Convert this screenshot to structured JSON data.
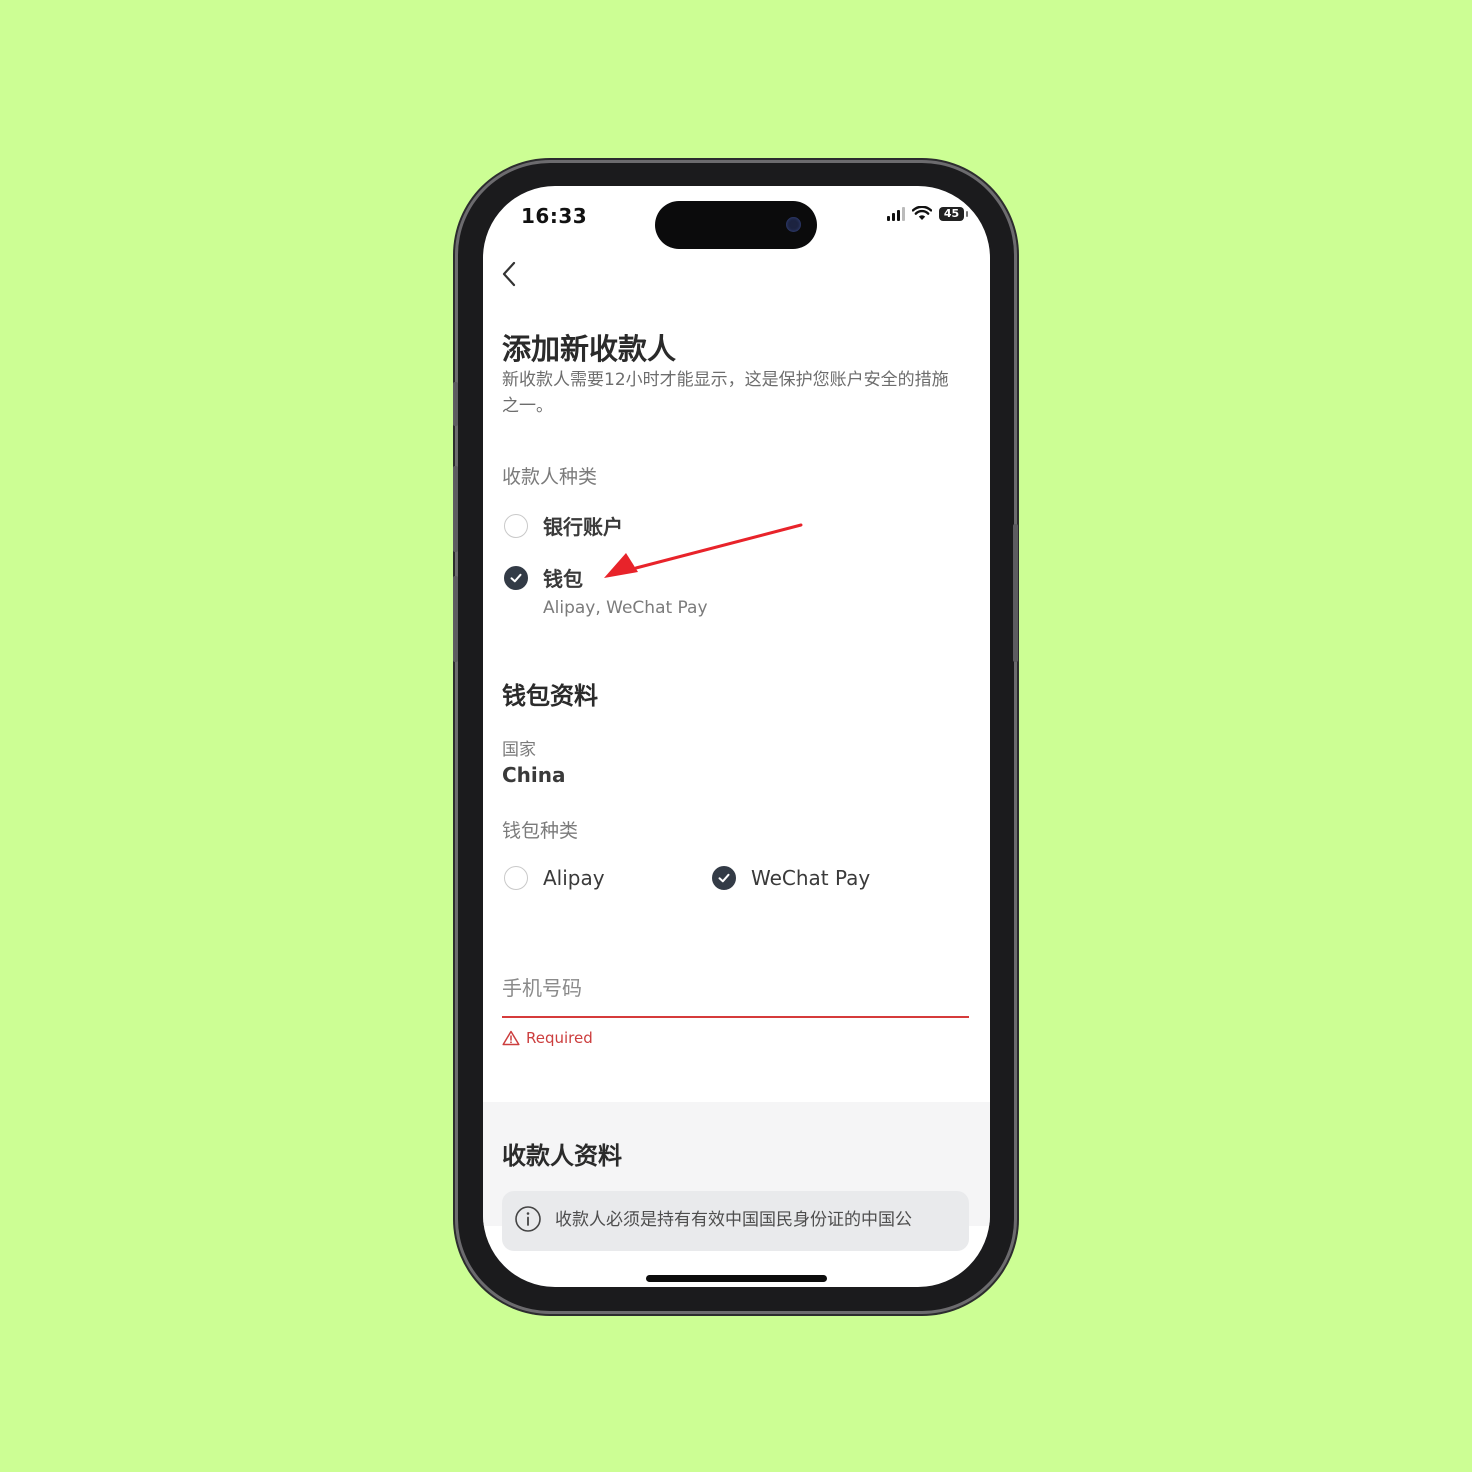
{
  "status_bar": {
    "time": "16:33",
    "battery": "45"
  },
  "header": {
    "title": "添加新收款人",
    "subtitle": "新收款人需要12小时才能显示，这是保护您账户安全的措施之一。"
  },
  "payee_type": {
    "label": "收款人种类",
    "options": [
      {
        "label": "银行账户",
        "checked": false
      },
      {
        "label": "钱包",
        "checked": true,
        "hint": "Alipay, WeChat Pay"
      }
    ]
  },
  "wallet_info": {
    "title": "钱包资料",
    "country_label": "国家",
    "country_value": "China",
    "wallet_type_label": "钱包种类",
    "wallet_options": [
      {
        "label": "Alipay",
        "checked": false
      },
      {
        "label": "WeChat Pay",
        "checked": true
      }
    ],
    "phone_label": "手机号码",
    "error_text": "Required"
  },
  "payee_info": {
    "title": "收款人资料",
    "notice": "收款人必须是持有有效中国国民身份证的中国公"
  },
  "colors": {
    "background": "#ccfe94",
    "accent_dark": "#333b46",
    "error_red": "#d63b3b",
    "annotation_arrow": "#e8232a"
  },
  "icons": {
    "back": "chevron-left-icon",
    "check": "check-icon",
    "warning": "warning-triangle-icon",
    "info": "info-circle-icon"
  }
}
